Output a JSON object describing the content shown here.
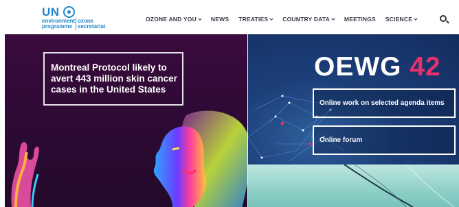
{
  "logo": {
    "un": "UN",
    "line1": "environment",
    "line2": "programme",
    "ozone1": "ozone",
    "ozone2": "secretariat",
    "brand_color": "#1f87c9"
  },
  "nav": {
    "items": [
      {
        "label": "OZONE AND YOU",
        "dropdown": true
      },
      {
        "label": "NEWS",
        "dropdown": false
      },
      {
        "label": "TREATIES",
        "dropdown": true
      },
      {
        "label": "COUNTRY DATA",
        "dropdown": true
      },
      {
        "label": "MEETINGS",
        "dropdown": false
      },
      {
        "label": "SCIENCE",
        "dropdown": true
      }
    ],
    "search_icon": "search-icon"
  },
  "hero_left": {
    "headline": "Montreal Protocol likely to avert 443 million skin cancer cases in the United States"
  },
  "hero_right": {
    "title_word": "OEWG",
    "title_number": "42",
    "title_number_color": "#e8306b",
    "button1": "Online work on selected agenda items",
    "button2": "Online forum"
  }
}
